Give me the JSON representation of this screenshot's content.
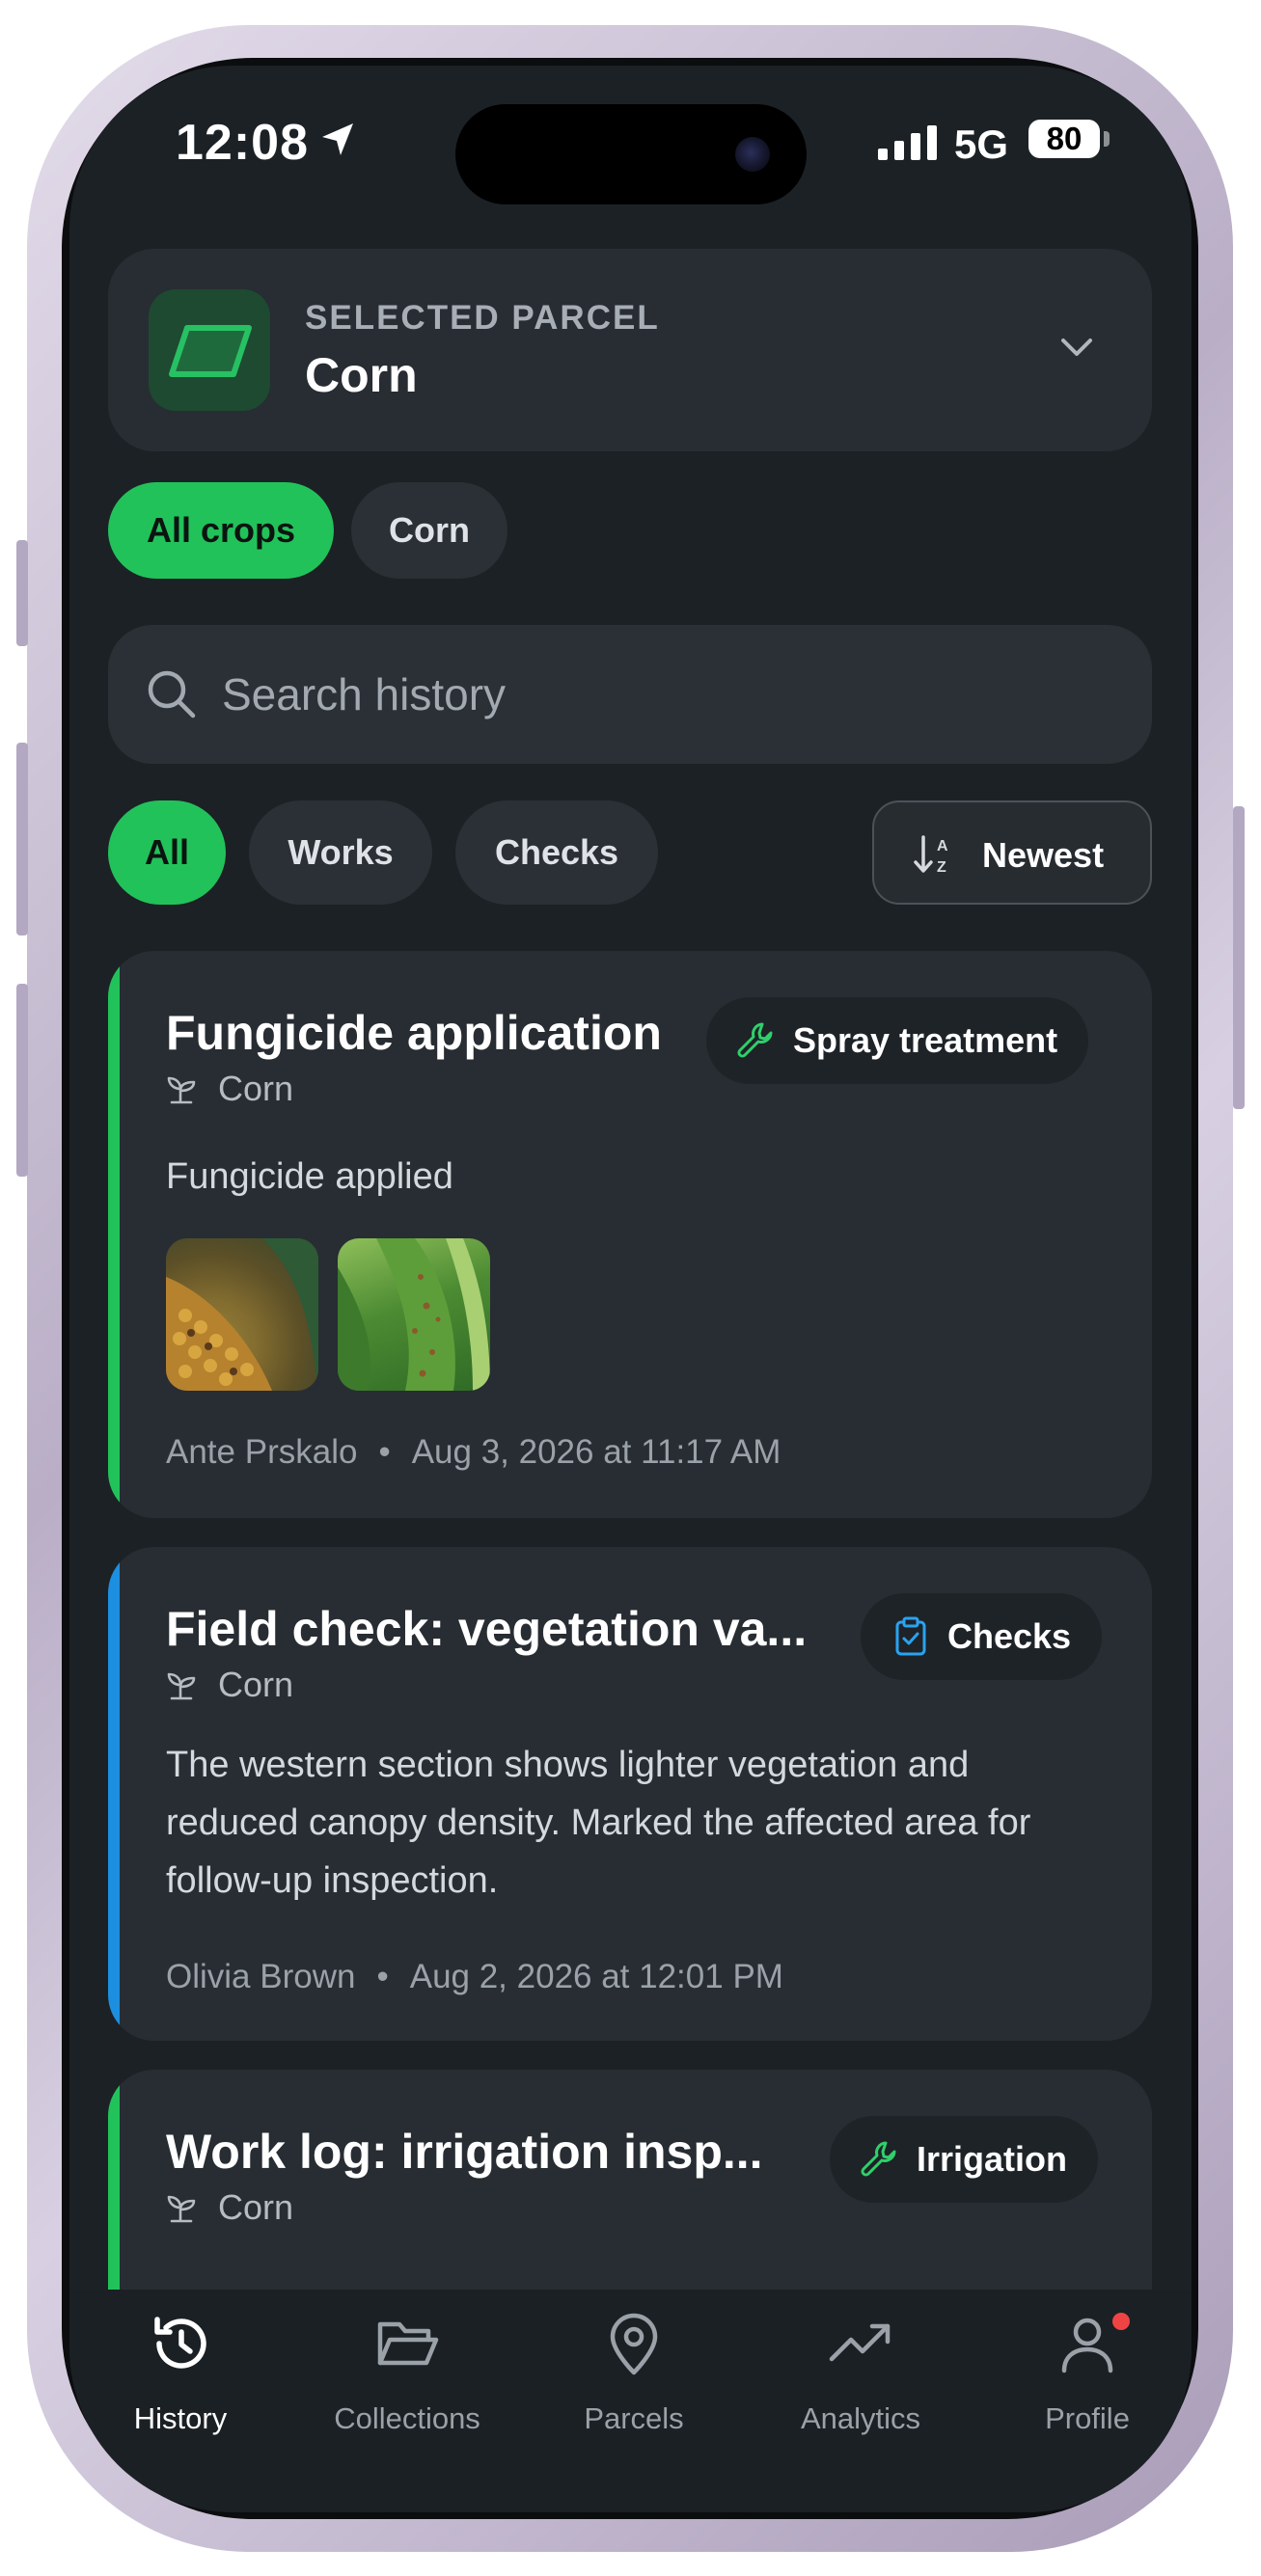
{
  "status_bar": {
    "time": "12:08",
    "network": "5G",
    "battery": "80"
  },
  "parcel": {
    "eyebrow": "SELECTED PARCEL",
    "name": "Corn"
  },
  "crop_filters": [
    {
      "label": "All crops",
      "active": true
    },
    {
      "label": "Corn",
      "active": false
    }
  ],
  "search": {
    "placeholder": "Search history",
    "value": ""
  },
  "type_filters": [
    {
      "label": "All",
      "active": true
    },
    {
      "label": "Works",
      "active": false
    },
    {
      "label": "Checks",
      "active": false
    }
  ],
  "sort": {
    "label": "Newest"
  },
  "history": [
    {
      "title": "Fungicide application",
      "tag": "Spray treatment",
      "tag_icon": "wrench-icon",
      "accent": "#22c25a",
      "crop": "Corn",
      "description": "Fungicide applied",
      "photos": [
        "corn-ear-photo",
        "corn-leaf-photo"
      ],
      "author": "Ante Prskalo",
      "timestamp": "Aug 3, 2026 at 11:17 AM"
    },
    {
      "title": "Field check: vegetation va...",
      "tag": "Checks",
      "tag_icon": "clipboard-check-icon",
      "accent": "#1d8fe0",
      "crop": "Corn",
      "description": "The western section shows lighter vegetation and reduced canopy density. Marked the affected area for follow-up inspection.",
      "author": "Olivia Brown",
      "timestamp": "Aug 2, 2026 at 12:01 PM"
    },
    {
      "title": "Work log: irrigation insp...",
      "tag": "Irrigation",
      "tag_icon": "wrench-icon",
      "accent": "#22c25a",
      "crop": "Corn"
    }
  ],
  "tabs": [
    {
      "label": "History",
      "icon": "history-icon",
      "active": true
    },
    {
      "label": "Collections",
      "icon": "folder-icon",
      "active": false
    },
    {
      "label": "Parcels",
      "icon": "map-pin-icon",
      "active": false
    },
    {
      "label": "Analytics",
      "icon": "trend-icon",
      "active": false
    },
    {
      "label": "Profile",
      "icon": "user-icon",
      "active": false,
      "badge": true
    }
  ],
  "colors": {
    "accent_green": "#22c25a",
    "accent_blue": "#1d8fe0",
    "background": "#1c2125",
    "card": "#272d32"
  }
}
